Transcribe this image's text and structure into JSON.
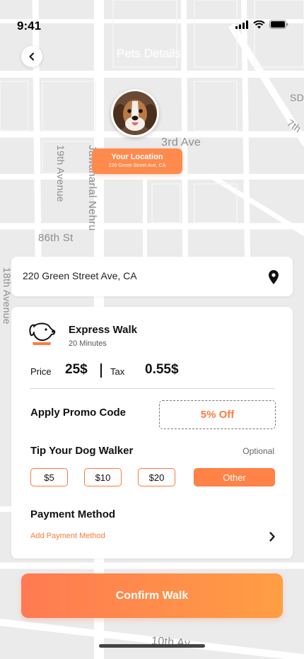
{
  "status_bar": {
    "time": "9:41"
  },
  "header": {
    "title": "Pets Details"
  },
  "map": {
    "streets": [
      "3rd Ave",
      "19th Avenue",
      "Jawaharlal Nehru",
      "86th St",
      "18th Avenue",
      "7th",
      "SD",
      "10th Av"
    ]
  },
  "location_tag": {
    "title": "Your Location",
    "subtitle": "220 Green Street Ave, CA"
  },
  "address_bar": {
    "address": "220 Green Street Ave, CA"
  },
  "service": {
    "name": "Express Walk",
    "duration": "20 Minutes"
  },
  "pricing": {
    "price_label": "Price",
    "price_value": "25$",
    "tax_label": "Tax",
    "tax_value": "0.55$"
  },
  "promo": {
    "label": "Apply Promo Code",
    "value": "5% Off"
  },
  "tip": {
    "label": "Tip Your Dog Walker",
    "optional_text": "Optional",
    "options": [
      "$5",
      "$10",
      "$20",
      "Other"
    ],
    "selected": "Other"
  },
  "payment": {
    "label": "Payment Method",
    "add_link": "Add Payment Method"
  },
  "confirm_button": {
    "label": "Confirm Walk"
  },
  "colors": {
    "accent": "#FF7A3D",
    "accent_light": "#FF9E43",
    "map_bg": "#EBEBEC",
    "road": "#FFFFFF"
  }
}
